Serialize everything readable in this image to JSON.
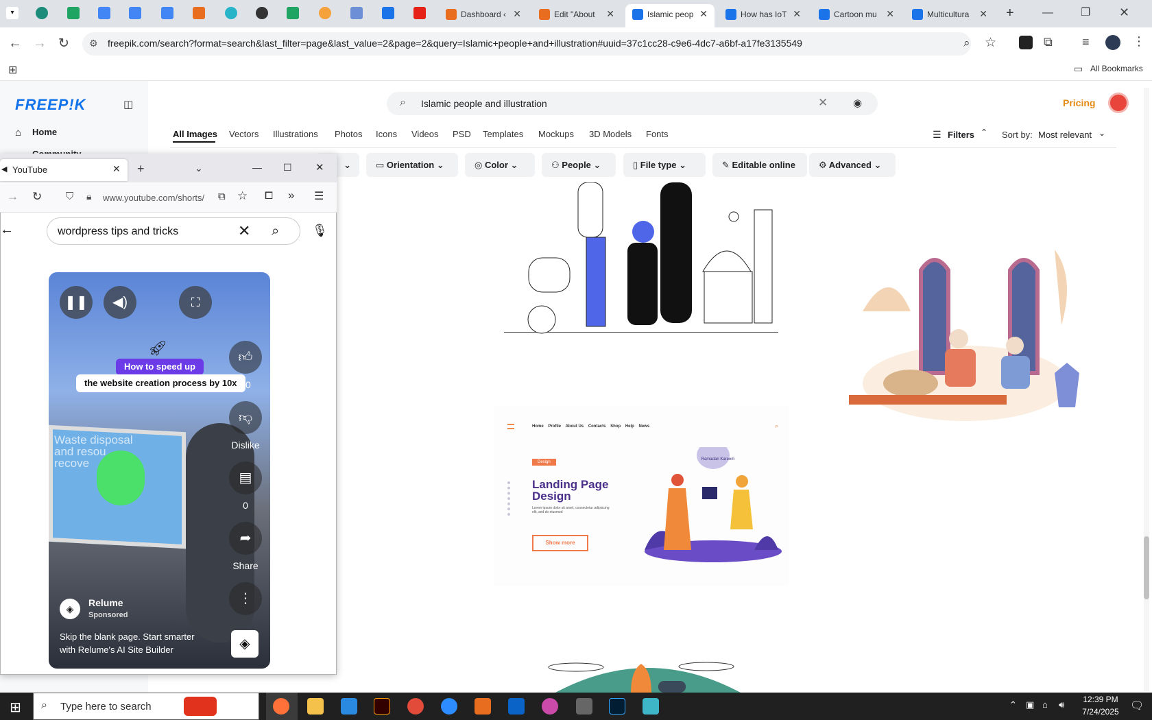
{
  "browser": {
    "tabs": [
      {
        "title": "Dashboard ‹"
      },
      {
        "title": "Edit \"About"
      },
      {
        "title": "Islamic peop"
      },
      {
        "title": "How has IoT"
      },
      {
        "title": "Cartoon mu"
      },
      {
        "title": "Multicultura"
      }
    ],
    "url": "freepik.com/search?format=search&last_filter=page&last_value=2&page=2&query=Islamic+people+and+illustration#uuid=37c1cc28-c9e6-4dc7-a6bf-a17fe3135549",
    "bookmarks_label": "All Bookmarks"
  },
  "freepik": {
    "logo": "FREEP!K",
    "nav": {
      "home": "Home",
      "community": "Community"
    },
    "search_value": "Islamic people and illustration",
    "pricing": "Pricing",
    "categories": [
      "All Images",
      "Vectors",
      "Illustrations",
      "Photos",
      "Icons",
      "Videos",
      "PSD",
      "Templates",
      "Mockups",
      "3D Models",
      "Fonts"
    ],
    "filters_label": "Filters",
    "sort_label": "Sort by:",
    "sort_value": "Most relevant",
    "chips": [
      "Orientation",
      "Color",
      "People",
      "File type",
      "Editable online",
      "Advanced"
    ],
    "landing": {
      "nav": [
        "Home",
        "Profile",
        "About Us",
        "Contacts",
        "Shop",
        "Help",
        "News"
      ],
      "badge": "Design",
      "title": "Landing Page Design",
      "body": "Lorem ipsum dolor sit amet, consectetur adipiscing elit, sed do eiusmod",
      "button": "Show more",
      "bubble": "Ramadan Kareem"
    }
  },
  "firefox": {
    "tab_title": "YouTube",
    "url": "www.youtube.com/shorts/",
    "search_value": "wordpress tips and tricks",
    "short": {
      "caption_line1": "How to speed up",
      "caption_line2": "the website creation process by 10x",
      "screen_text": "Waste disposal and resou recove",
      "like_count": "40",
      "dislike_label": "Dislike",
      "comment_count": "0",
      "share_label": "Share",
      "channel": "Relume",
      "sponsored": "Sponsored",
      "desc_line1": "Skip the blank page. Start smarter",
      "desc_line2": "with Relume's AI Site Builder"
    }
  },
  "taskbar": {
    "search_placeholder": "Type here to search",
    "time": "12:39 PM",
    "date": "7/24/2025"
  }
}
